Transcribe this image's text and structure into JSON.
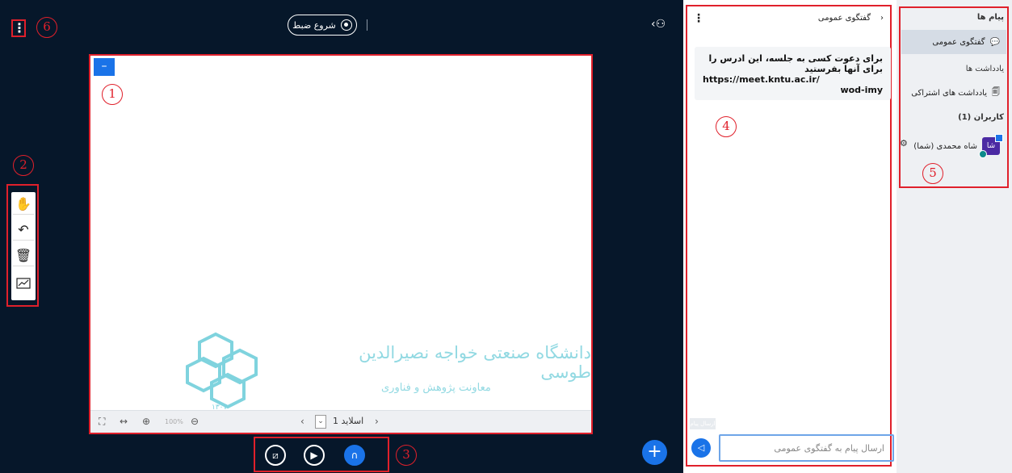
{
  "annotations": [
    "1",
    "2",
    "3",
    "4",
    "5",
    "6"
  ],
  "top": {
    "record_label": "شروع ضبط"
  },
  "slide": {
    "logo_line1": "دانشگاه صنعتی خواجه نصیرالدین طوسی",
    "logo_line2": "معاونت پژوهش و فناوری",
    "logo_year": "۱۳۰۷",
    "slide_label": "اسلاید 1",
    "zoom_label": "100%"
  },
  "icons": {
    "hand": "hand-icon",
    "undo": "undo-icon",
    "trash": "trash-icon",
    "chart": "chart-icon",
    "fullscreen": "fullscreen-icon",
    "fitwidth": "fit-width-icon",
    "zoomin": "zoom-in-icon",
    "zoomout": "zoom-out-icon",
    "screenshare": "screen-share-icon",
    "camera": "camera-icon",
    "audio": "headphones-icon",
    "plus": "plus-icon"
  },
  "chat": {
    "title": "گفتگوی عمومی",
    "message_line1": "برای دعوت کسی به جلسه، این ادرس را برای آنها بفرستید",
    "message_line2": "https://meet.kntu.ac.ir/",
    "message_line3": "wod-imy",
    "input_placeholder": "ارسال پیام به گفتگوی عمومی",
    "ghost": "ارسال پیام"
  },
  "sidebar": {
    "messages_title": "پیام ها",
    "public_chat": "گفتگوی عمومی",
    "notes_title": "یادداشت ها",
    "shared_notes": "یادداشت های اشتراکی",
    "users_title": "کاربران (1)",
    "user_name": "شاه محمدی (شما)",
    "user_initials": "شا"
  }
}
